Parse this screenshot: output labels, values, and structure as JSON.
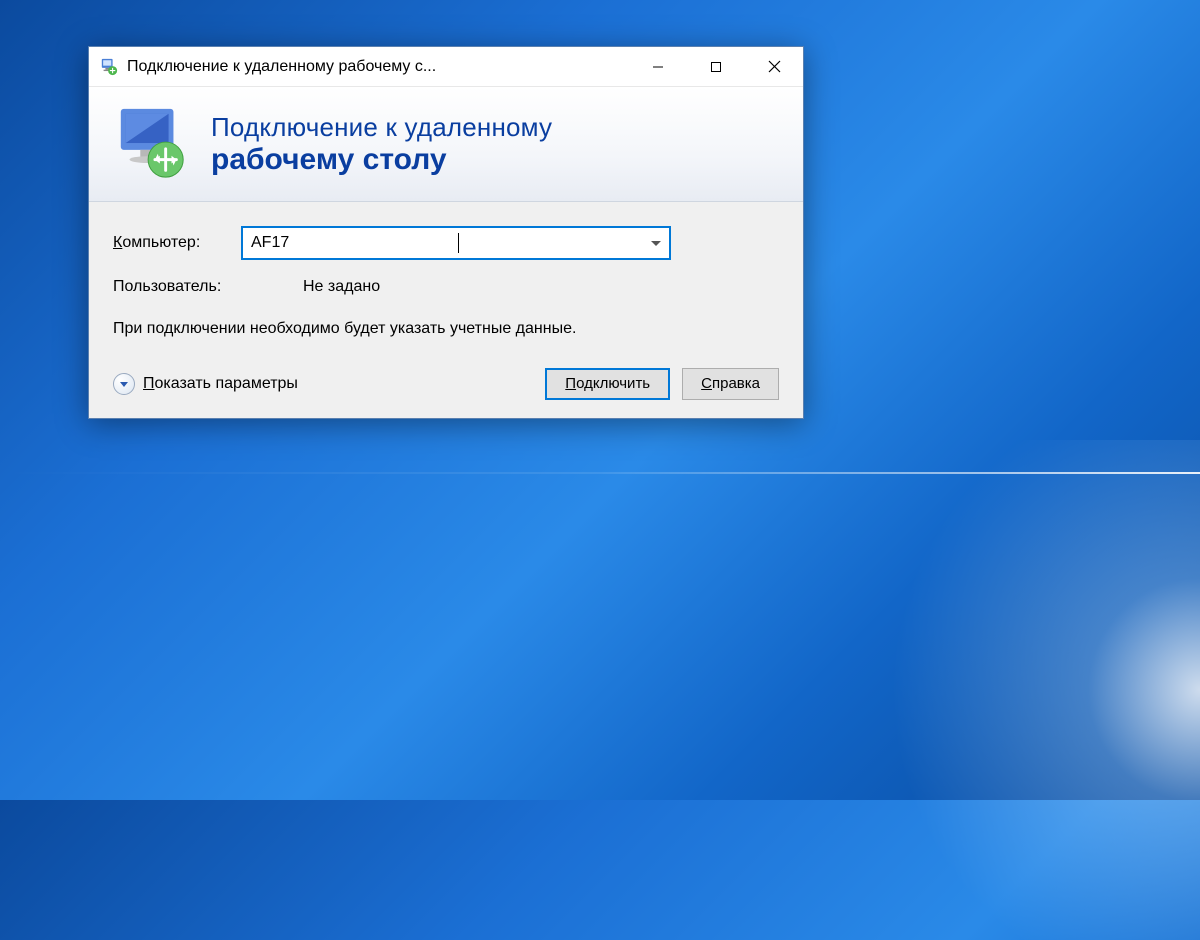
{
  "titlebar": {
    "title": "Подключение к удаленному рабочему с..."
  },
  "header": {
    "line1": "Подключение к удаленному",
    "line2": "рабочему столу"
  },
  "form": {
    "computer_label_pre": "К",
    "computer_label_post": "омпьютер:",
    "computer_value": "AF17",
    "user_label": "Пользователь:",
    "user_value": "Не задано",
    "info_text": "При подключении необходимо будет указать учетные данные."
  },
  "footer": {
    "show_options_pre": "П",
    "show_options_post": "оказать параметры",
    "connect_pre": "П",
    "connect_post": "одключить",
    "help_pre": "С",
    "help_post": "правка"
  }
}
